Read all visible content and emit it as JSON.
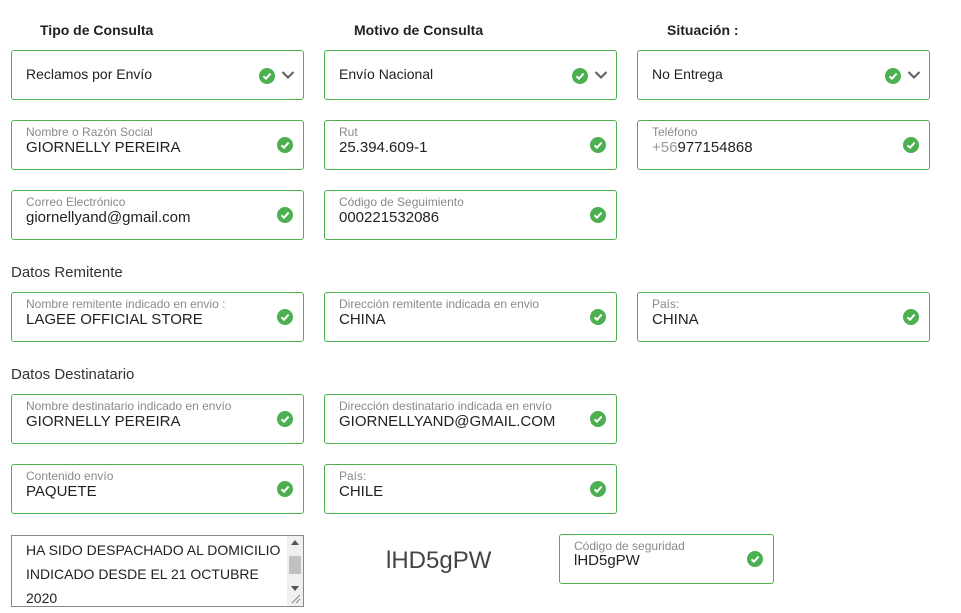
{
  "headers": {
    "tipo": "Tipo de Consulta",
    "motivo": "Motivo de Consulta",
    "situacion": "Situación :"
  },
  "selects": {
    "tipo": "Reclamos por Envío",
    "motivo": "Envío Nacional",
    "situacion": "No Entrega"
  },
  "fields": {
    "nombre": {
      "label": "Nombre o Razón Social",
      "value": "GIORNELLY PEREIRA"
    },
    "rut": {
      "label": "Rut",
      "value": "25.394.609-1"
    },
    "telefono": {
      "label": "Teléfono",
      "prefix": "+56",
      "value": "977154868"
    },
    "correo": {
      "label": "Correo Electrónico",
      "value": "giornellyand@gmail.com"
    },
    "seguimiento": {
      "label": "Código de Seguimiento",
      "value": "000221532086"
    }
  },
  "remitente": {
    "title": "Datos Remitente",
    "nombre": {
      "label": "Nombre remitente indicado en envio :",
      "value": "LAGEE OFFICIAL STORE"
    },
    "direccion": {
      "label": "Dirección remitente indicada en envio",
      "value": "CHINA"
    },
    "pais": {
      "label": "País:",
      "value": "CHINA"
    }
  },
  "destinatario": {
    "title": "Datos Destinatario",
    "nombre": {
      "label": "Nombre destinatario indicado en envío",
      "value": "GIORNELLY PEREIRA"
    },
    "direccion": {
      "label": "Dirección destinatario indicada en envío",
      "value": "GIORNELLYAND@GMAIL.COM"
    },
    "contenido": {
      "label": "Contenido envío",
      "value": "PAQUETE"
    },
    "pais": {
      "label": "País:",
      "value": "CHILE"
    }
  },
  "message": "HA SIDO DESPACHADO AL DOMICILIO INDICADO DESDE EL 21 OCTUBRE 2020",
  "captcha": {
    "image_text": "lHD5gPW",
    "label": "Código de seguridad",
    "value": "lHD5gPW"
  },
  "colors": {
    "accent": "#4caf50",
    "border": "#4caf50"
  },
  "icons": {
    "valid": "check-circle-icon",
    "dropdown": "chevron-down-icon"
  }
}
